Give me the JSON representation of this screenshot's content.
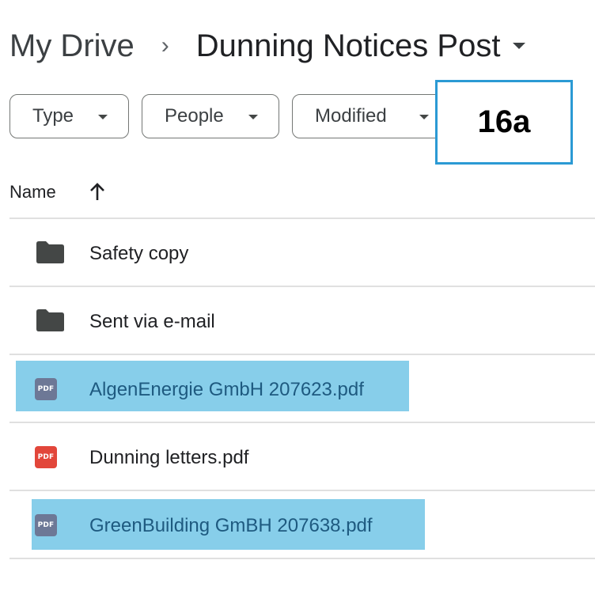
{
  "breadcrumb": {
    "root": "My Drive",
    "separator": "›",
    "current": "Dunning Notices Post"
  },
  "filters": [
    {
      "label": "Type"
    },
    {
      "label": "People"
    },
    {
      "label": "Modified"
    }
  ],
  "callout": "16a",
  "list": {
    "header": "Name",
    "items": [
      {
        "name": "Safety copy",
        "kind": "folder-icon"
      },
      {
        "name": "Sent via e-mail",
        "kind": "folder-icon"
      },
      {
        "name": "AlgenEnergie GmbH 207623.pdf",
        "kind": "pdf-icon",
        "badge": "PDF",
        "selected": true
      },
      {
        "name": "Dunning letters.pdf",
        "kind": "pdf-icon",
        "badge": "PDF",
        "selected": false
      },
      {
        "name": "GreenBuilding GmBH 207638.pdf",
        "kind": "pdf-icon",
        "badge": "PDF",
        "selected": true
      }
    ]
  },
  "colors": {
    "highlight": "#87ceea",
    "callout_border": "#2b9ad4",
    "pdf_red": "#e2463a",
    "pdf_selected": "#6d7896",
    "folder": "#444746"
  }
}
